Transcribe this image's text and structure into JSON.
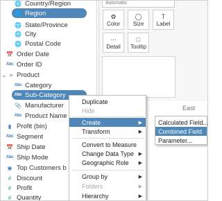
{
  "colors": {
    "selection": "#4e87b8",
    "dimension_icon": "#3f7fbf",
    "measure_icon": "#2f9e7a"
  },
  "data_pane": {
    "fields": [
      {
        "label": "Country/Region",
        "icon": "globe-icon"
      },
      {
        "label": "Region",
        "icon": "globe-icon"
      },
      {
        "label": "State/Province",
        "icon": "globe-icon"
      },
      {
        "label": "City",
        "icon": "globe-icon"
      },
      {
        "label": "Postal Code",
        "icon": "globe-icon"
      },
      {
        "label": "Order Date",
        "icon": "calendar-icon"
      },
      {
        "label": "Order ID",
        "icon": "abc-icon"
      },
      {
        "label": "Product",
        "icon": "hierarchy-icon"
      },
      {
        "label": "Category",
        "icon": "abc-icon"
      },
      {
        "label": "Sub-Category",
        "icon": "abc-icon"
      },
      {
        "label": "Manufacturer",
        "icon": "paperclip-icon"
      },
      {
        "label": "Product Name",
        "icon": "abc-icon"
      },
      {
        "label": "Profit (bin)",
        "icon": "bin-icon"
      },
      {
        "label": "Segment",
        "icon": "abc-icon"
      },
      {
        "label": "Ship Date",
        "icon": "calendar-icon"
      },
      {
        "label": "Ship Mode",
        "icon": "abc-icon"
      },
      {
        "label": "Top Customers b",
        "icon": "set-icon"
      },
      {
        "label": "Discount",
        "icon": "hash-icon"
      },
      {
        "label": "Profit",
        "icon": "hash-icon"
      },
      {
        "label": "Quantity",
        "icon": "hash-icon"
      }
    ]
  },
  "marks": {
    "mark_type": "Automatic",
    "buttons": [
      {
        "label": "Color",
        "icon": "color-icon"
      },
      {
        "label": "Size",
        "icon": "size-icon"
      },
      {
        "label": "Label",
        "icon": "label-icon"
      },
      {
        "label": "Detail",
        "icon": "detail-icon"
      },
      {
        "label": "Tooltip",
        "icon": "tooltip-icon"
      }
    ]
  },
  "view": {
    "east_label": "East"
  },
  "context_menu": {
    "items": [
      {
        "label": "Duplicate"
      },
      {
        "label": "Hide"
      },
      {
        "label": "Create"
      },
      {
        "label": "Transform"
      },
      {
        "label": "Convert to Measure"
      },
      {
        "label": "Change Data Type"
      },
      {
        "label": "Geographic Role"
      },
      {
        "label": "Group by"
      },
      {
        "label": "Folders"
      },
      {
        "label": "Hierarchy"
      }
    ]
  },
  "create_submenu": {
    "items": [
      {
        "label": "Calculated Field..."
      },
      {
        "label": "Combined Field"
      },
      {
        "label": "Parameter..."
      }
    ]
  }
}
